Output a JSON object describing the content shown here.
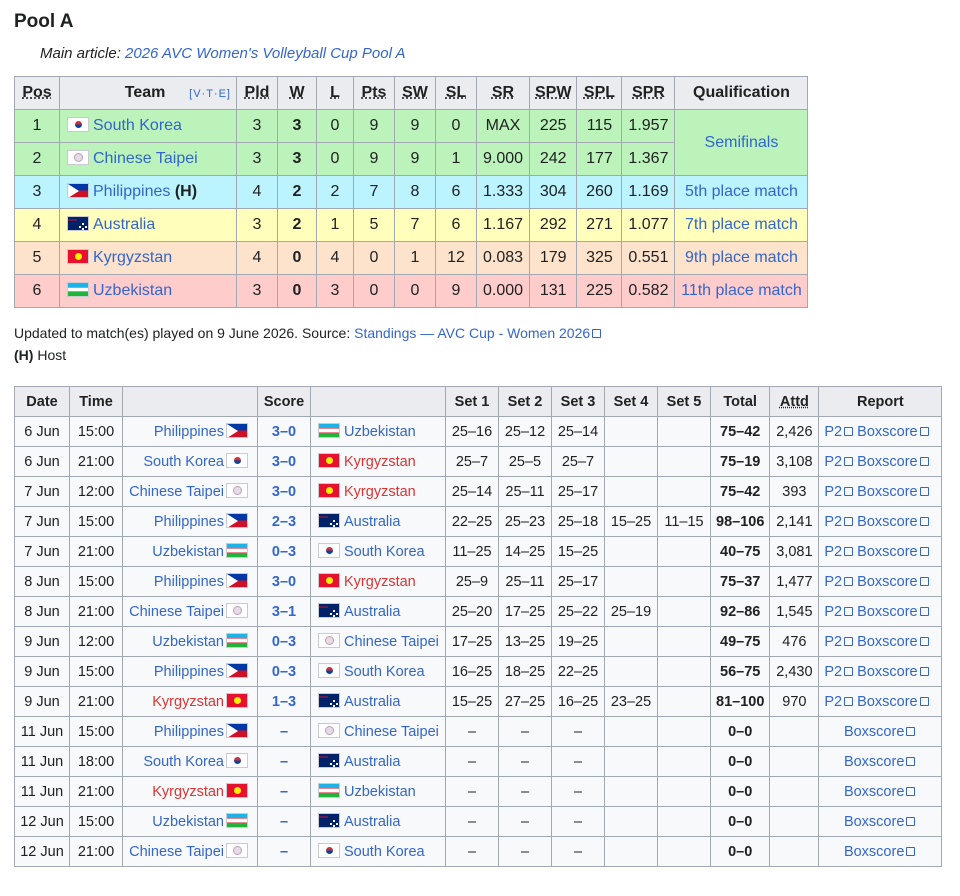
{
  "heading": "Pool A",
  "hatnote": {
    "prefix": "Main article: ",
    "link": "2026 AVC Women's Volleyball Cup Pool A"
  },
  "standings": {
    "headers": [
      "Pos",
      "Team",
      "Pld",
      "W",
      "L",
      "Pts",
      "SW",
      "SL",
      "SR",
      "SPW",
      "SPL",
      "SPR",
      "Qualification"
    ],
    "vte": "[V·T·E]",
    "rows": [
      {
        "pos": "1",
        "team": "South Korea",
        "flag": "kr",
        "host": "",
        "pld": "3",
        "w": "3",
        "l": "0",
        "pts": "9",
        "sw": "9",
        "sl": "0",
        "sr": "MAX",
        "spw": "225",
        "spl": "115",
        "spr": "1.957",
        "cls": "r-semi"
      },
      {
        "pos": "2",
        "team": "Chinese Taipei",
        "flag": "tp",
        "host": "",
        "pld": "3",
        "w": "3",
        "l": "0",
        "pts": "9",
        "sw": "9",
        "sl": "1",
        "sr": "9.000",
        "spw": "242",
        "spl": "177",
        "spr": "1.367",
        "cls": "r-semi"
      },
      {
        "pos": "3",
        "team": "Philippines",
        "flag": "ph",
        "host": "(H)",
        "pld": "4",
        "w": "2",
        "l": "2",
        "pts": "7",
        "sw": "8",
        "sl": "6",
        "sr": "1.333",
        "spw": "304",
        "spl": "260",
        "spr": "1.169",
        "cls": "r-5"
      },
      {
        "pos": "4",
        "team": "Australia",
        "flag": "au",
        "host": "",
        "pld": "3",
        "w": "2",
        "l": "1",
        "pts": "5",
        "sw": "7",
        "sl": "6",
        "sr": "1.167",
        "spw": "292",
        "spl": "271",
        "spr": "1.077",
        "cls": "r-7"
      },
      {
        "pos": "5",
        "team": "Kyrgyzstan",
        "flag": "kg",
        "host": "",
        "pld": "4",
        "w": "0",
        "l": "4",
        "pts": "0",
        "sw": "1",
        "sl": "12",
        "sr": "0.083",
        "spw": "179",
        "spl": "325",
        "spr": "0.551",
        "cls": "r-9"
      },
      {
        "pos": "6",
        "team": "Uzbekistan",
        "flag": "uz",
        "host": "",
        "pld": "3",
        "w": "0",
        "l": "3",
        "pts": "0",
        "sw": "0",
        "sl": "9",
        "sr": "0.000",
        "spw": "131",
        "spl": "225",
        "spr": "0.582",
        "cls": "r-11"
      }
    ],
    "qualification": [
      "Semifinals",
      "5th place match",
      "7th place match",
      "9th place match",
      "11th place match"
    ]
  },
  "notes": {
    "updated_prefix": "Updated to match(es) played on 9 June 2026. Source: ",
    "source_link": "Standings — AVC Cup - Women 2026",
    "host_key": "(H)",
    "host_label": " Host"
  },
  "matches": {
    "headers": [
      "Date",
      "Time",
      "",
      "Score",
      "",
      "Set 1",
      "Set 2",
      "Set 3",
      "Set 4",
      "Set 5",
      "Total",
      "Attd",
      "Report"
    ],
    "p2": "P2",
    "boxscore": "Boxscore",
    "rows": [
      {
        "date": "6 Jun",
        "time": "15:00",
        "home": "Philippines",
        "hf": "ph",
        "score": "3–0",
        "away": "Uzbekistan",
        "af": "uz",
        "s1": "25–16",
        "s2": "25–12",
        "s3": "25–14",
        "s4": "",
        "s5": "",
        "total": "75–42",
        "attd": "2,426",
        "p2": true
      },
      {
        "date": "6 Jun",
        "time": "21:00",
        "home": "South Korea",
        "hf": "kr",
        "score": "3–0",
        "away": "Kyrgyzstan",
        "af": "kg",
        "s1": "25–7",
        "s2": "25–5",
        "s3": "25–7",
        "s4": "",
        "s5": "",
        "total": "75–19",
        "attd": "3,108",
        "p2": true
      },
      {
        "date": "7 Jun",
        "time": "12:00",
        "home": "Chinese Taipei",
        "hf": "tp",
        "score": "3–0",
        "away": "Kyrgyzstan",
        "af": "kg",
        "s1": "25–14",
        "s2": "25–11",
        "s3": "25–17",
        "s4": "",
        "s5": "",
        "total": "75–42",
        "attd": "393",
        "p2": true
      },
      {
        "date": "7 Jun",
        "time": "15:00",
        "home": "Philippines",
        "hf": "ph",
        "score": "2–3",
        "away": "Australia",
        "af": "au",
        "s1": "22–25",
        "s2": "25–23",
        "s3": "25–18",
        "s4": "15–25",
        "s5": "11–15",
        "total": "98–106",
        "attd": "2,141",
        "p2": true
      },
      {
        "date": "7 Jun",
        "time": "21:00",
        "home": "Uzbekistan",
        "hf": "uz",
        "score": "0–3",
        "away": "South Korea",
        "af": "kr",
        "s1": "11–25",
        "s2": "14–25",
        "s3": "15–25",
        "s4": "",
        "s5": "",
        "total": "40–75",
        "attd": "3,081",
        "p2": true
      },
      {
        "date": "8 Jun",
        "time": "15:00",
        "home": "Philippines",
        "hf": "ph",
        "score": "3–0",
        "away": "Kyrgyzstan",
        "af": "kg",
        "s1": "25–9",
        "s2": "25–11",
        "s3": "25–17",
        "s4": "",
        "s5": "",
        "total": "75–37",
        "attd": "1,477",
        "p2": true
      },
      {
        "date": "8 Jun",
        "time": "21:00",
        "home": "Chinese Taipei",
        "hf": "tp",
        "score": "3–1",
        "away": "Australia",
        "af": "au",
        "s1": "25–20",
        "s2": "17–25",
        "s3": "25–22",
        "s4": "25–19",
        "s5": "",
        "total": "92–86",
        "attd": "1,545",
        "p2": true
      },
      {
        "date": "9 Jun",
        "time": "12:00",
        "home": "Uzbekistan",
        "hf": "uz",
        "score": "0–3",
        "away": "Chinese Taipei",
        "af": "tp",
        "s1": "17–25",
        "s2": "13–25",
        "s3": "19–25",
        "s4": "",
        "s5": "",
        "total": "49–75",
        "attd": "476",
        "p2": true
      },
      {
        "date": "9 Jun",
        "time": "15:00",
        "home": "Philippines",
        "hf": "ph",
        "score": "0–3",
        "away": "South Korea",
        "af": "kr",
        "s1": "16–25",
        "s2": "18–25",
        "s3": "22–25",
        "s4": "",
        "s5": "",
        "total": "56–75",
        "attd": "2,430",
        "p2": true
      },
      {
        "date": "9 Jun",
        "time": "21:00",
        "home": "Kyrgyzstan",
        "hf": "kg",
        "score": "1–3",
        "away": "Australia",
        "af": "au",
        "s1": "15–25",
        "s2": "27–25",
        "s3": "16–25",
        "s4": "23–25",
        "s5": "",
        "total": "81–100",
        "attd": "970",
        "p2": true
      },
      {
        "date": "11 Jun",
        "time": "15:00",
        "home": "Philippines",
        "hf": "ph",
        "score": "–",
        "away": "Chinese Taipei",
        "af": "tp",
        "s1": "–",
        "s2": "–",
        "s3": "–",
        "s4": "",
        "s5": "",
        "total": "0–0",
        "attd": "",
        "p2": false
      },
      {
        "date": "11 Jun",
        "time": "18:00",
        "home": "South Korea",
        "hf": "kr",
        "score": "–",
        "away": "Australia",
        "af": "au",
        "s1": "–",
        "s2": "–",
        "s3": "–",
        "s4": "",
        "s5": "",
        "total": "0–0",
        "attd": "",
        "p2": false
      },
      {
        "date": "11 Jun",
        "time": "21:00",
        "home": "Kyrgyzstan",
        "hf": "kg",
        "score": "–",
        "away": "Uzbekistan",
        "af": "uz",
        "s1": "–",
        "s2": "–",
        "s3": "–",
        "s4": "",
        "s5": "",
        "total": "0–0",
        "attd": "",
        "p2": false
      },
      {
        "date": "12 Jun",
        "time": "15:00",
        "home": "Uzbekistan",
        "hf": "uz",
        "score": "–",
        "away": "Australia",
        "af": "au",
        "s1": "–",
        "s2": "–",
        "s3": "–",
        "s4": "",
        "s5": "",
        "total": "0–0",
        "attd": "",
        "p2": false
      },
      {
        "date": "12 Jun",
        "time": "21:00",
        "home": "Chinese Taipei",
        "hf": "tp",
        "score": "–",
        "away": "South Korea",
        "af": "kr",
        "s1": "–",
        "s2": "–",
        "s3": "–",
        "s4": "",
        "s5": "",
        "total": "0–0",
        "attd": "",
        "p2": false
      }
    ]
  },
  "team_colors": {
    "Kyrgyzstan": "#d33",
    "default": "#3366cc"
  }
}
